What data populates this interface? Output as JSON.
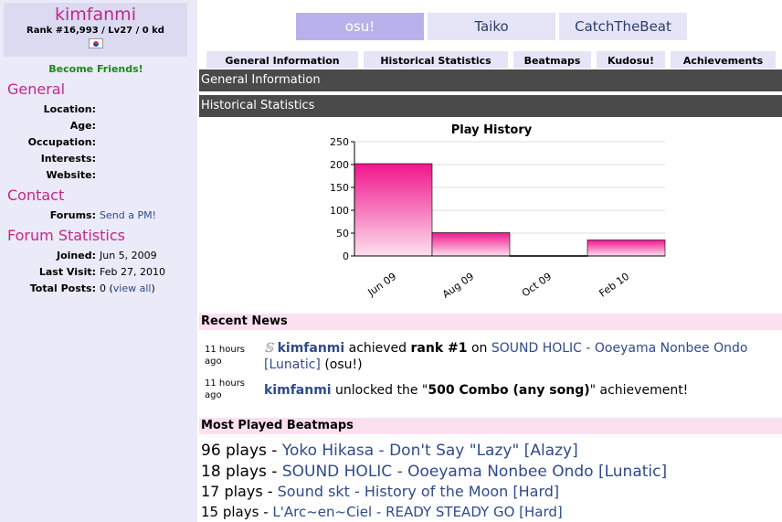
{
  "profile": {
    "username": "kimfanmi",
    "rank_line": "Rank #16,993 / Lv27 / 0 kd",
    "become_friends": "Become Friends!"
  },
  "general": {
    "title": "General",
    "fields": [
      {
        "label": "Location:",
        "value": ""
      },
      {
        "label": "Age:",
        "value": ""
      },
      {
        "label": "Occupation:",
        "value": ""
      },
      {
        "label": "Interests:",
        "value": ""
      },
      {
        "label": "Website:",
        "value": ""
      }
    ]
  },
  "contact": {
    "title": "Contact",
    "forums_label": "Forums:",
    "forums_link": "Send a PM!"
  },
  "forum_stats": {
    "title": "Forum Statistics",
    "joined_label": "Joined:",
    "joined_value": "Jun 5, 2009",
    "last_visit_label": "Last Visit:",
    "last_visit_value": "Feb 27, 2010",
    "total_posts_label": "Total Posts:",
    "total_posts_value": "0 (",
    "view_all": "view all",
    "total_posts_close": ")"
  },
  "mode_tabs": [
    "osu!",
    "Taiko",
    "CatchTheBeat"
  ],
  "sub_tabs": [
    "General Information",
    "Historical Statistics",
    "Beatmaps",
    "Kudosu!",
    "Achievements"
  ],
  "headers": {
    "general_info": "General Information",
    "historical": "Historical Statistics"
  },
  "chart_data": {
    "type": "bar",
    "title": "Play History",
    "categories": [
      "Jun 09",
      "Aug 09",
      "Oct 09",
      "Feb 10"
    ],
    "values": [
      202,
      51,
      1,
      35
    ],
    "ylim": [
      0,
      250
    ],
    "yticks": [
      "0",
      "50",
      "100",
      "150",
      "200",
      "250"
    ],
    "xlabel": "",
    "ylabel": "",
    "grid": true,
    "bar_color_top": "#f0158c",
    "bar_color_bottom": "#fde0ee"
  },
  "recent_news": {
    "title": "Recent News",
    "items": [
      {
        "time": "11 hours ago",
        "user": "kimfanmi",
        "text1": " achieved ",
        "bold": "rank #1",
        "text2": " on ",
        "link": "SOUND HOLIC - Ooeyama Nonbee Ondo [Lunatic]",
        "text3": " (osu!)"
      },
      {
        "time": "11 hours ago",
        "user": "kimfanmi",
        "text1": " unlocked the \"",
        "bold": "500 Combo (any song)",
        "text2": "\" achievement!"
      }
    ]
  },
  "most_played": {
    "title": "Most Played Beatmaps",
    "items": [
      {
        "plays": "96 plays - ",
        "map": "Yoko Hikasa - Don't Say \"Lazy\" [Alazy]"
      },
      {
        "plays": "18 plays - ",
        "map": "SOUND HOLIC - Ooeyama Nonbee Ondo [Lunatic]"
      },
      {
        "plays": "17 plays - ",
        "map": "Sound skt - History of the Moon [Hard]"
      },
      {
        "plays": "15 plays - ",
        "map": "L'Arc~en~Ciel - READY STEADY GO [Hard]"
      }
    ]
  },
  "colors": {
    "accent_pink": "#c3278a",
    "link_blue": "#2f4a8c",
    "friends_green": "#1a8a1a",
    "header_dark": "#4a4a4a",
    "sidebar_bg": "#ebeaf8"
  }
}
